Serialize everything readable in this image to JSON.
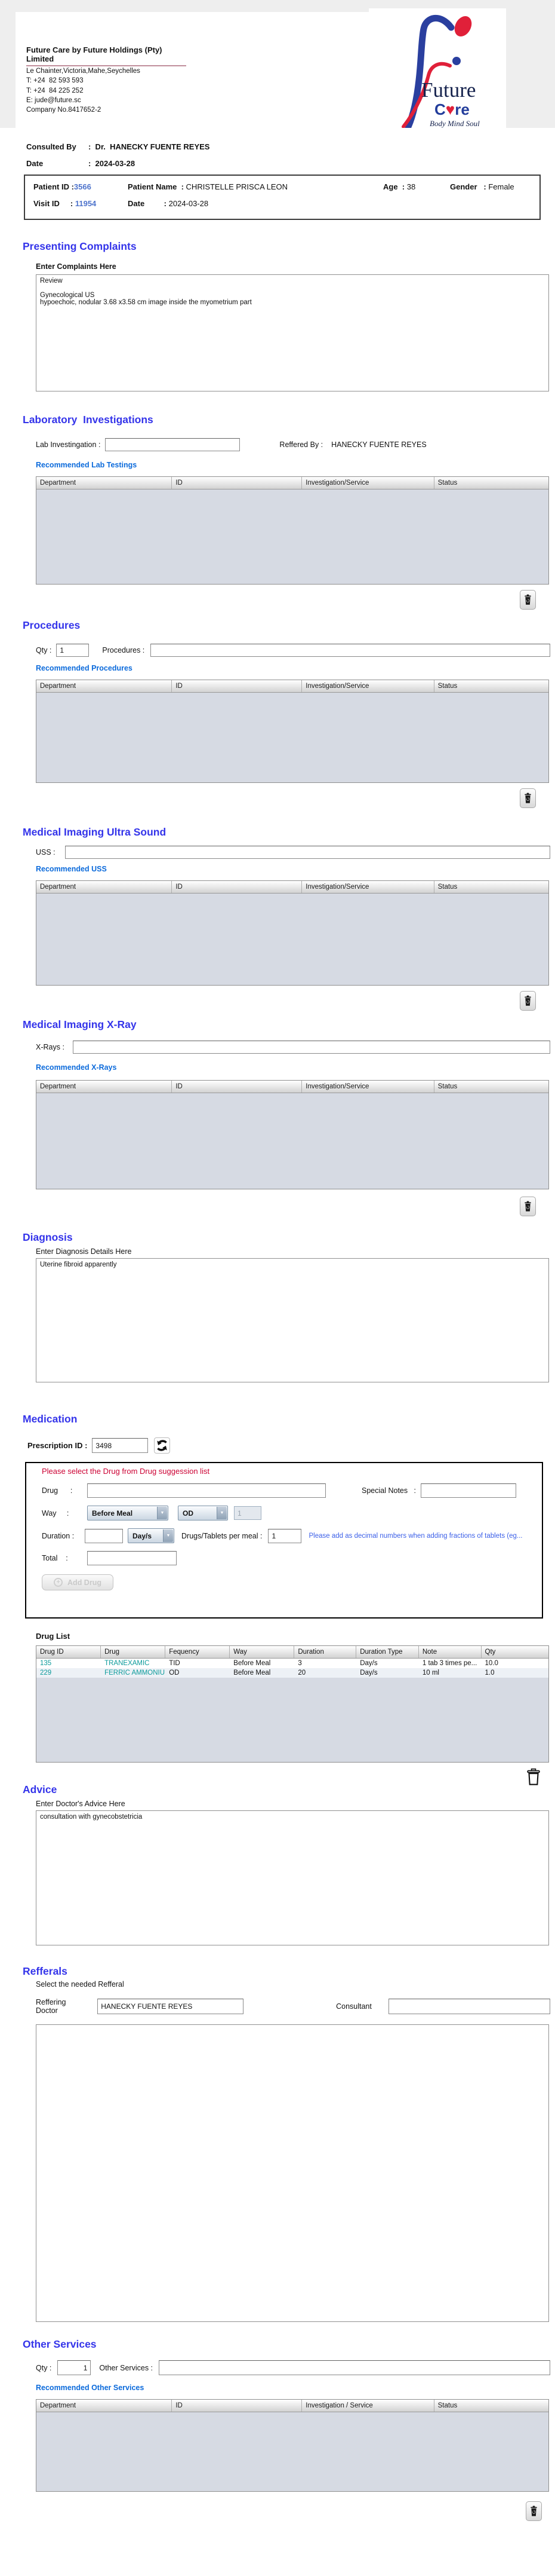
{
  "letterhead": {
    "company_title": "Future Care by Future Holdings (Pty) Limited",
    "address_lines": [
      "Le Chainter,Victoria,Mahe,Seychelles",
      "T: +24  82 593 593",
      "T: +24  84 225 252",
      "E: jude@future.sc",
      "Company No.8417652-2"
    ],
    "logo": {
      "word_future": "Future",
      "care_c": "C",
      "care_re": "re",
      "heart": "♥",
      "tagline": "Body Mind Soul"
    }
  },
  "consult": {
    "row1_label": "Consulted By",
    "row1_value": ":  Dr.  HANECKY FUENTE REYES",
    "row2_label": "Date",
    "row2_value": ":  2024-03-28"
  },
  "patient_bar": {
    "patient_id_label": "Patient ID :",
    "patient_id_value": "3566",
    "patient_name_label": "Patient Name  :",
    "patient_name_value": "CHRISTELLE PRISCA LEON",
    "age_label": "Age  :",
    "age_value": "38",
    "gender_label": "Gender   :",
    "gender_value": "Female",
    "visit_id_label": "Visit ID     :",
    "visit_id_value": "11954",
    "date_label": "Date         :",
    "date_value": "2024-03-28"
  },
  "presenting_complaints": {
    "heading": "Presenting Complaints",
    "label": "Enter Complaints Here",
    "text": "Review\n\nGynecological US\nhypoechoic, nodular 3.68 x3.58 cm image inside the myometrium part"
  },
  "laboratory": {
    "heading": "Laboratory  Investigations",
    "input_label": "Lab Investingation :",
    "referred_label": "Reffered By :",
    "referred_value": "HANECKY FUENTE REYES",
    "link": "Recommended Lab Testings",
    "headers": [
      "Department",
      "ID",
      "Investigation/Service",
      "Status"
    ]
  },
  "procedures": {
    "heading": "Procedures",
    "qty_label": "Qty :",
    "qty_value": "1",
    "input_label": "Procedures :",
    "link": "Recommended Procedures",
    "headers": [
      "Department",
      "ID",
      "Investigation/Service",
      "Status"
    ]
  },
  "ultrasound": {
    "heading": "Medical Imaging Ultra Sound",
    "input_label": "USS :",
    "link": "Recommended USS",
    "headers": [
      "Department",
      "ID",
      "Investigation/Service",
      "Status"
    ]
  },
  "xray": {
    "heading": "Medical Imaging X-Ray",
    "input_label": "X-Rays :",
    "link": "Recommended X-Rays",
    "headers": [
      "Department",
      "ID",
      "Investigation/Service",
      "Status"
    ]
  },
  "diagnosis": {
    "heading": "Diagnosis",
    "label": "Enter Diagnosis Details Here",
    "text": "Uterine fibroid apparently"
  },
  "medication": {
    "heading": "Medication",
    "prescription_label": "Prescription ID :",
    "prescription_id": "3498",
    "form": {
      "warning": "Please select the Drug from Drug suggession list",
      "drug_label": "Drug      :",
      "special_notes_label": "Special Notes   :",
      "way_label": "Way     :",
      "way_value": "Before Meal",
      "frequency_value": "OD",
      "frequency_qty": "1",
      "duration_label": "Duration :",
      "duration_unit": "Day/s",
      "per_meal_label": "Drugs/Tablets per meal :",
      "per_meal_value": "1",
      "hint": "Please add as decimal numbers when adding fractions of tablets (eg...",
      "total_label": "Total    :",
      "add_button": "Add Drug"
    },
    "drug_list": {
      "label": "Drug List",
      "headers": [
        "Drug ID",
        "Drug",
        "Fequency",
        "Way",
        "Duration",
        "Duration Type",
        "Note",
        "Qty"
      ],
      "rows": [
        {
          "id": "135",
          "drug": "TRANEXAMIC",
          "frequency": "TID",
          "way": "Before Meal",
          "duration": "3",
          "duration_type": "Day/s",
          "note": "1 tab 3 times pe...",
          "qty": "10.0"
        },
        {
          "id": "229",
          "drug": "FERRIC AMMONIU",
          "frequency": "OD",
          "way": "Before Meal",
          "duration": "20",
          "duration_type": "Day/s",
          "note": "10 ml",
          "qty": "1.0"
        }
      ]
    }
  },
  "advice": {
    "heading": "Advice",
    "label": "Enter Doctor's Advice Here",
    "text": "consultation with gynecobstetricia"
  },
  "refferals": {
    "heading": "Refferals",
    "label": "Select the needed Refferal",
    "doctor_label": "Reffering Doctor",
    "doctor_value": "HANECKY FUENTE REYES",
    "consultant_label": "Consultant"
  },
  "other_services": {
    "heading": "Other Services",
    "qty_label": "Qty :",
    "qty_value": "1",
    "input_label": "Other Services :",
    "link": "Recommended Other Services",
    "headers": [
      "Department",
      "ID",
      "Investigation / Service",
      "Status"
    ]
  },
  "icons": {
    "dropdown_arrow": "▼",
    "plus": "+"
  }
}
